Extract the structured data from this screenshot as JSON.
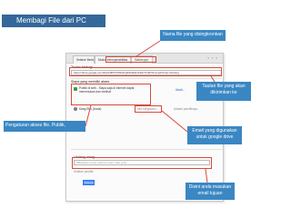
{
  "slide": {
    "title": "Membagi File dari PC"
  },
  "dialog": {
    "tabs": [
      "Setelan Berbagi",
      "Modul Interoperabilitas",
      "Gdrive.ppt"
    ],
    "link_section_title": "Tautan berbagi",
    "share_link": "https://drive.google.com/file/d/0B7FfHNfcbQ0lNdkdFNnMxTGZhWmc/edit?usp=sharing",
    "access_section_title": "Siapa yang memiliki akses",
    "access_row_title": "Publik di web - Siapa saja di Internet dapat",
    "access_row_subtitle": "menemukan dan melihat",
    "access_row_action": "Ubah...",
    "owner_name": "Kang Eko (Anda)",
    "owner_email": "eko.s@gmail.c...",
    "owner_role": "Adalah pemiliknya",
    "invite_section_title": "Undang orang:",
    "invite_placeholder": "Masukkan nama, alamat email, atau grup...",
    "owner_settings_text": "Setelan pemilik",
    "done_button": "Selesai"
  },
  "callouts": {
    "file_name": "Nama file yang disingkronkan",
    "share_link": "Tautan file yang akan dikirimkan ke",
    "access": "Pengaturan akses file. Publik,",
    "email": "Email yang digunakan untuk google drive",
    "invite": "Disini anda masukan email tujuan"
  },
  "colors": {
    "header_bar": "#34689a",
    "callout": "#3a87c3",
    "highlight_frame": "#d84a3b",
    "primary_button": "#4d90fe"
  }
}
